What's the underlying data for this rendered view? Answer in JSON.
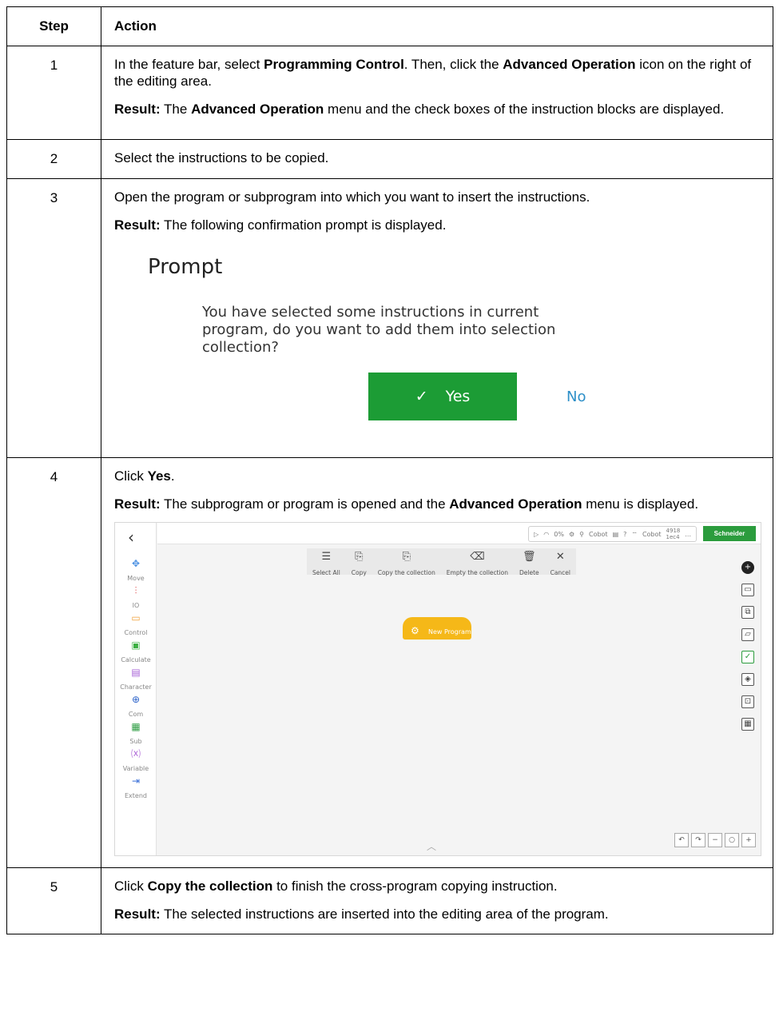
{
  "headers": {
    "step": "Step",
    "action": "Action"
  },
  "rows": {
    "r1": {
      "num": "1",
      "p1_a": "In the feature bar, select ",
      "p1_b": "Programming Control",
      "p1_c": ". Then, click the ",
      "p1_d": "Advanced Operation",
      "p1_e": " icon on the right of the editing area.",
      "res_label": "Result:",
      "p2_a": " The ",
      "p2_b": "Advanced Operation",
      "p2_c": " menu and the check boxes of the instruction blocks are displayed."
    },
    "r2": {
      "num": "2",
      "text": "Select the instructions to be copied."
    },
    "r3": {
      "num": "3",
      "text": "Open the program or subprogram into which you want to insert the instructions.",
      "res_label": "Result:",
      "res_text": " The following confirmation prompt is displayed."
    },
    "r4": {
      "num": "4",
      "p1_a": "Click ",
      "p1_b": "Yes",
      "p1_c": ".",
      "res_label": "Result:",
      "p2_a": " The subprogram or program is opened and the ",
      "p2_b": "Advanced Operation",
      "p2_c": " menu is displayed."
    },
    "r5": {
      "num": "5",
      "p1_a": "Click ",
      "p1_b": "Copy the collection",
      "p1_c": " to finish the cross-program copying instruction.",
      "res_label": "Result:",
      "res_text": " The selected instructions are inserted into the editing area of the program."
    }
  },
  "prompt": {
    "title": "Prompt",
    "message": "You have selected some instructions in current program, do you want to add them into selection collection?",
    "yes": "Yes",
    "no": "No",
    "colors": {
      "yes_bg": "#1c9c35",
      "no_text": "#2d8fc8"
    }
  },
  "app": {
    "sidebar": [
      {
        "label": "Move",
        "icon": "move-icon",
        "color": "#4a90e2"
      },
      {
        "label": "IO",
        "icon": "io-icon",
        "color": "#e05555"
      },
      {
        "label": "Control",
        "icon": "control-icon",
        "color": "#f0a23c"
      },
      {
        "label": "Calculate",
        "icon": "calculate-icon",
        "color": "#3cb043"
      },
      {
        "label": "Character",
        "icon": "character-icon",
        "color": "#a55fd6"
      },
      {
        "label": "Com",
        "icon": "com-icon",
        "color": "#2a62c9"
      },
      {
        "label": "Sub",
        "icon": "sub-icon",
        "color": "#2f9e44"
      },
      {
        "label": "Variable",
        "icon": "variable-icon",
        "color": "#b06ad8"
      },
      {
        "label": "Extend",
        "icon": "extend-icon",
        "color": "#3a6fd8"
      }
    ],
    "status": {
      "percent": "0%",
      "cobot1": "Cobot",
      "cobot2": "Cobot",
      "id_top": "4918",
      "id_bottom": "1ec4",
      "more": "...",
      "help": "?"
    },
    "logo": "Schneider",
    "toolbar": [
      {
        "label": "Select All",
        "icon": "select-all-icon"
      },
      {
        "label": "Copy",
        "icon": "copy-icon"
      },
      {
        "label": "Copy the collection",
        "icon": "copy-collection-icon"
      },
      {
        "label": "Empty the collection",
        "icon": "empty-collection-icon"
      },
      {
        "label": "Delete",
        "icon": "delete-icon"
      },
      {
        "label": "Cancel",
        "icon": "cancel-icon"
      }
    ],
    "block_label": "New Program",
    "brand_green": "#2b9c3d",
    "block_color": "#f5b818"
  }
}
